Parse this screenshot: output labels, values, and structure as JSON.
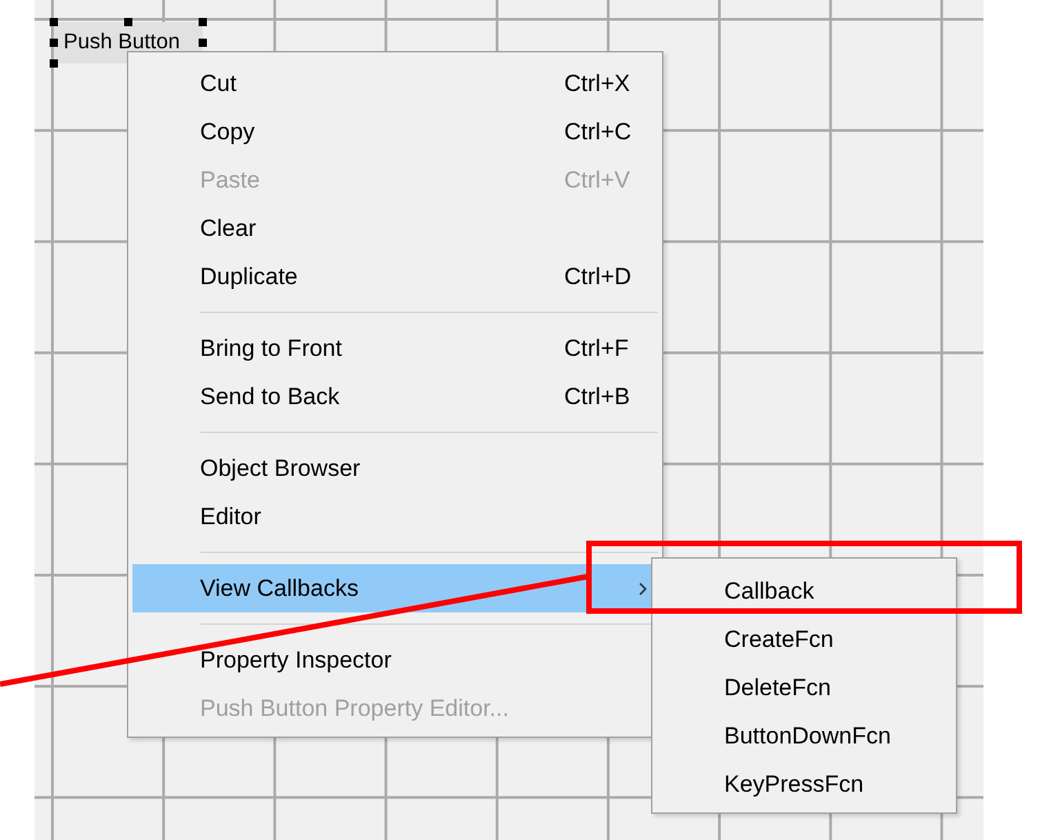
{
  "canvas": {
    "control": {
      "label": "Push Button",
      "selected": true
    }
  },
  "context_menu": {
    "items": [
      {
        "kind": "item",
        "label": "Cut",
        "shortcut": "Ctrl+X",
        "disabled": false,
        "highlighted": false
      },
      {
        "kind": "item",
        "label": "Copy",
        "shortcut": "Ctrl+C",
        "disabled": false,
        "highlighted": false
      },
      {
        "kind": "item",
        "label": "Paste",
        "shortcut": "Ctrl+V",
        "disabled": true,
        "highlighted": false
      },
      {
        "kind": "item",
        "label": "Clear",
        "disabled": false,
        "highlighted": false
      },
      {
        "kind": "item",
        "label": "Duplicate",
        "shortcut": "Ctrl+D",
        "disabled": false,
        "highlighted": false
      },
      {
        "kind": "separator"
      },
      {
        "kind": "item",
        "label": "Bring to Front",
        "shortcut": "Ctrl+F",
        "disabled": false,
        "highlighted": false
      },
      {
        "kind": "item",
        "label": "Send to Back",
        "shortcut": "Ctrl+B",
        "disabled": false,
        "highlighted": false
      },
      {
        "kind": "separator"
      },
      {
        "kind": "item",
        "label": "Object Browser",
        "disabled": false,
        "highlighted": false
      },
      {
        "kind": "item",
        "label": "Editor",
        "disabled": false,
        "highlighted": false
      },
      {
        "kind": "separator"
      },
      {
        "kind": "submenu",
        "label": "View Callbacks",
        "disabled": false,
        "highlighted": true
      },
      {
        "kind": "separator"
      },
      {
        "kind": "item",
        "label": "Property Inspector",
        "disabled": false,
        "highlighted": false
      },
      {
        "kind": "item",
        "label": "Push Button Property Editor...",
        "disabled": true,
        "highlighted": false
      }
    ]
  },
  "submenu": {
    "items": [
      {
        "label": "Callback",
        "highlighted": false
      },
      {
        "label": "CreateFcn",
        "highlighted": false
      },
      {
        "label": "DeleteFcn",
        "highlighted": false
      },
      {
        "label": "ButtonDownFcn",
        "highlighted": false
      },
      {
        "label": "KeyPressFcn",
        "highlighted": false
      }
    ]
  }
}
